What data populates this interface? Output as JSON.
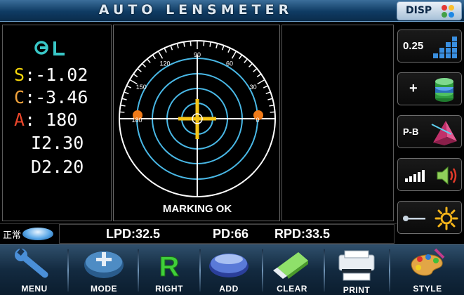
{
  "header": {
    "title": "AUTO LENSMETER",
    "disp_label": "DISP",
    "disp_colors": [
      "#e53935",
      "#fbc02d",
      "#43a047",
      "#1e88e5"
    ]
  },
  "logo": {
    "text": "CL"
  },
  "readings": {
    "s_key": "S",
    "s_value": ":-1.02",
    "c_key": "C",
    "c_value": ":-3.46",
    "a_key": "A",
    "a_value": ": 180",
    "i_value": "I2.30",
    "d_value": "D2.20",
    "key_colors": {
      "s": "#f5d60a",
      "c": "#f0a23c",
      "a": "#e8452a"
    }
  },
  "target": {
    "degree_labels": [
      "180",
      "150",
      "120",
      "90",
      "60",
      "30",
      "0"
    ],
    "marking_status": "MARKING OK"
  },
  "sidebar": {
    "step_label": "0.25",
    "sign_label": "+",
    "prism_label": "P-B"
  },
  "pd_bar": {
    "status_label": "正常",
    "lpd": "LPD:32.5",
    "pd": "PD:66",
    "rpd": "RPD:33.5"
  },
  "toolbar": {
    "items": [
      {
        "label": "MENU",
        "icon": "wrench-icon"
      },
      {
        "label": "MODE",
        "icon": "mode-icon"
      },
      {
        "label": "RIGHT",
        "icon": "right-r-icon"
      },
      {
        "label": "ADD",
        "icon": "add-icon"
      },
      {
        "label": "CLEAR",
        "icon": "eraser-icon"
      },
      {
        "label": "PRINT",
        "icon": "printer-icon"
      },
      {
        "label": "STYLE",
        "icon": "palette-icon"
      }
    ]
  }
}
